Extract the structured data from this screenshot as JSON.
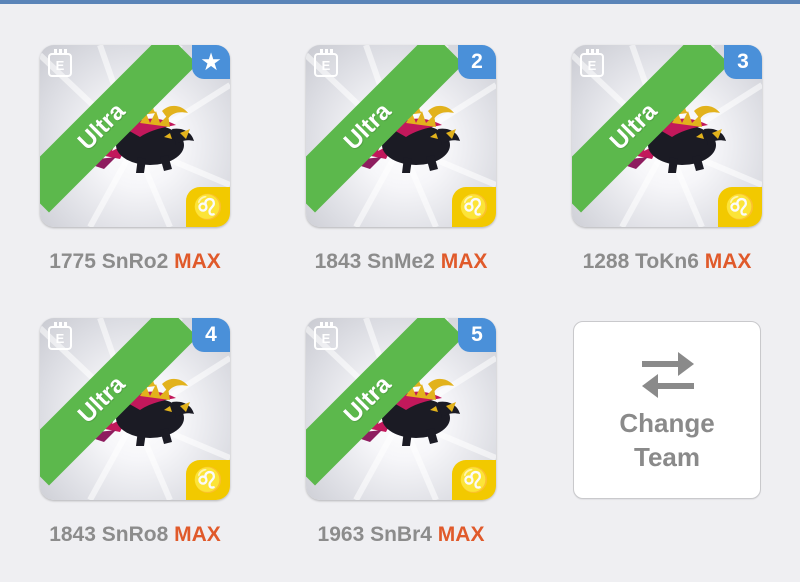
{
  "team": [
    {
      "rarity": "Ultra",
      "slot_badge": "★",
      "slot_icon": "star-icon",
      "zodiac": "♌",
      "cp": "1775",
      "name": "SnRo2",
      "level": "MAX"
    },
    {
      "rarity": "Ultra",
      "slot_badge": "2",
      "slot_icon": "",
      "zodiac": "♌",
      "cp": "1843",
      "name": "SnMe2",
      "level": "MAX"
    },
    {
      "rarity": "Ultra",
      "slot_badge": "3",
      "slot_icon": "",
      "zodiac": "♌",
      "cp": "1288",
      "name": "ToKn6",
      "level": "MAX"
    },
    {
      "rarity": "Ultra",
      "slot_badge": "4",
      "slot_icon": "",
      "zodiac": "♌",
      "cp": "1843",
      "name": "SnRo8",
      "level": "MAX"
    },
    {
      "rarity": "Ultra",
      "slot_badge": "5",
      "slot_icon": "",
      "zodiac": "♌",
      "cp": "1963",
      "name": "SnBr4",
      "level": "MAX"
    }
  ],
  "change_team": {
    "line1": "Change",
    "line2": "Team",
    "icon": "swap-arrows-icon"
  },
  "colors": {
    "ribbon": "#5cb84c",
    "badge": "#4a90d9",
    "zodiac": "#f2c900",
    "max": "#e05a2b",
    "label": "#8c8c8c"
  }
}
